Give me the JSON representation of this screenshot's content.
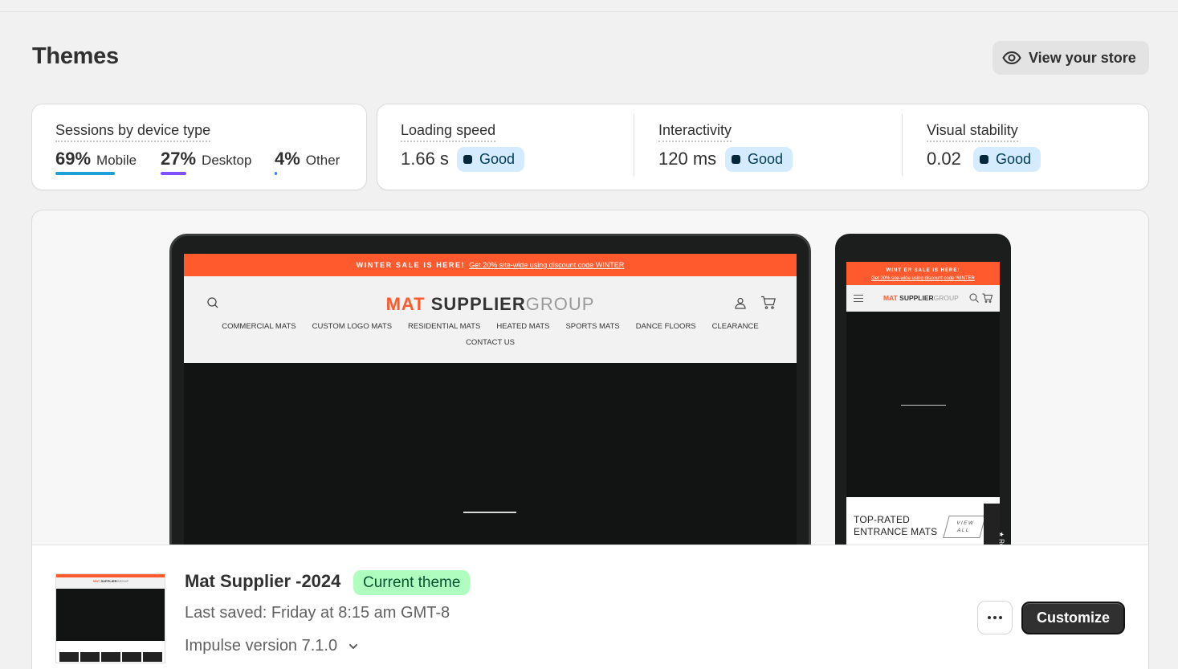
{
  "header": {
    "title": "Themes",
    "view_store_label": "View your store"
  },
  "sessions": {
    "title": "Sessions by device type",
    "devices": [
      {
        "pct": "69%",
        "label": "Mobile",
        "color": "#1ea1d9"
      },
      {
        "pct": "27%",
        "label": "Desktop",
        "color": "#8051ff"
      },
      {
        "pct": "4%",
        "label": "Other",
        "color": "#3f7cf4"
      }
    ]
  },
  "vitals": [
    {
      "title": "Loading speed",
      "value": "1.66 s",
      "status": "Good"
    },
    {
      "title": "Interactivity",
      "value": "120 ms",
      "status": "Good"
    },
    {
      "title": "Visual stability",
      "value": "0.02",
      "status": "Good"
    }
  ],
  "preview": {
    "announcement_strong": "WINTER SALE IS HERE!",
    "announcement_link": "Get 20% site-wide using discount code WINTER",
    "phone_announcement_strong": "WINT ER SALE IS HERE!",
    "logo": {
      "mat": "MAT",
      "supplier": "SUPPLIER",
      "group": "GROUP"
    },
    "nav": [
      "COMMERCIAL MATS",
      "CUSTOM LOGO MATS",
      "RESIDENTIAL MATS",
      "HEATED MATS",
      "SPORTS MATS",
      "DANCE FLOORS",
      "CLEARANCE",
      "CONTACT US"
    ],
    "phone_section_title_1": "TOP-RATED",
    "phone_section_title_2": "ENTRANCE MATS",
    "phone_view_all_1": "VIEW",
    "phone_view_all_2": "ALL",
    "phone_reviews": "★ Reviews",
    "brand_color": "#ff5a2e"
  },
  "theme": {
    "name": "Mat Supplier -2024",
    "badge": "Current theme",
    "last_saved": "Last saved: Friday at 8:15 am GMT-8",
    "version": "Impulse version 7.1.0",
    "customize_label": "Customize"
  }
}
